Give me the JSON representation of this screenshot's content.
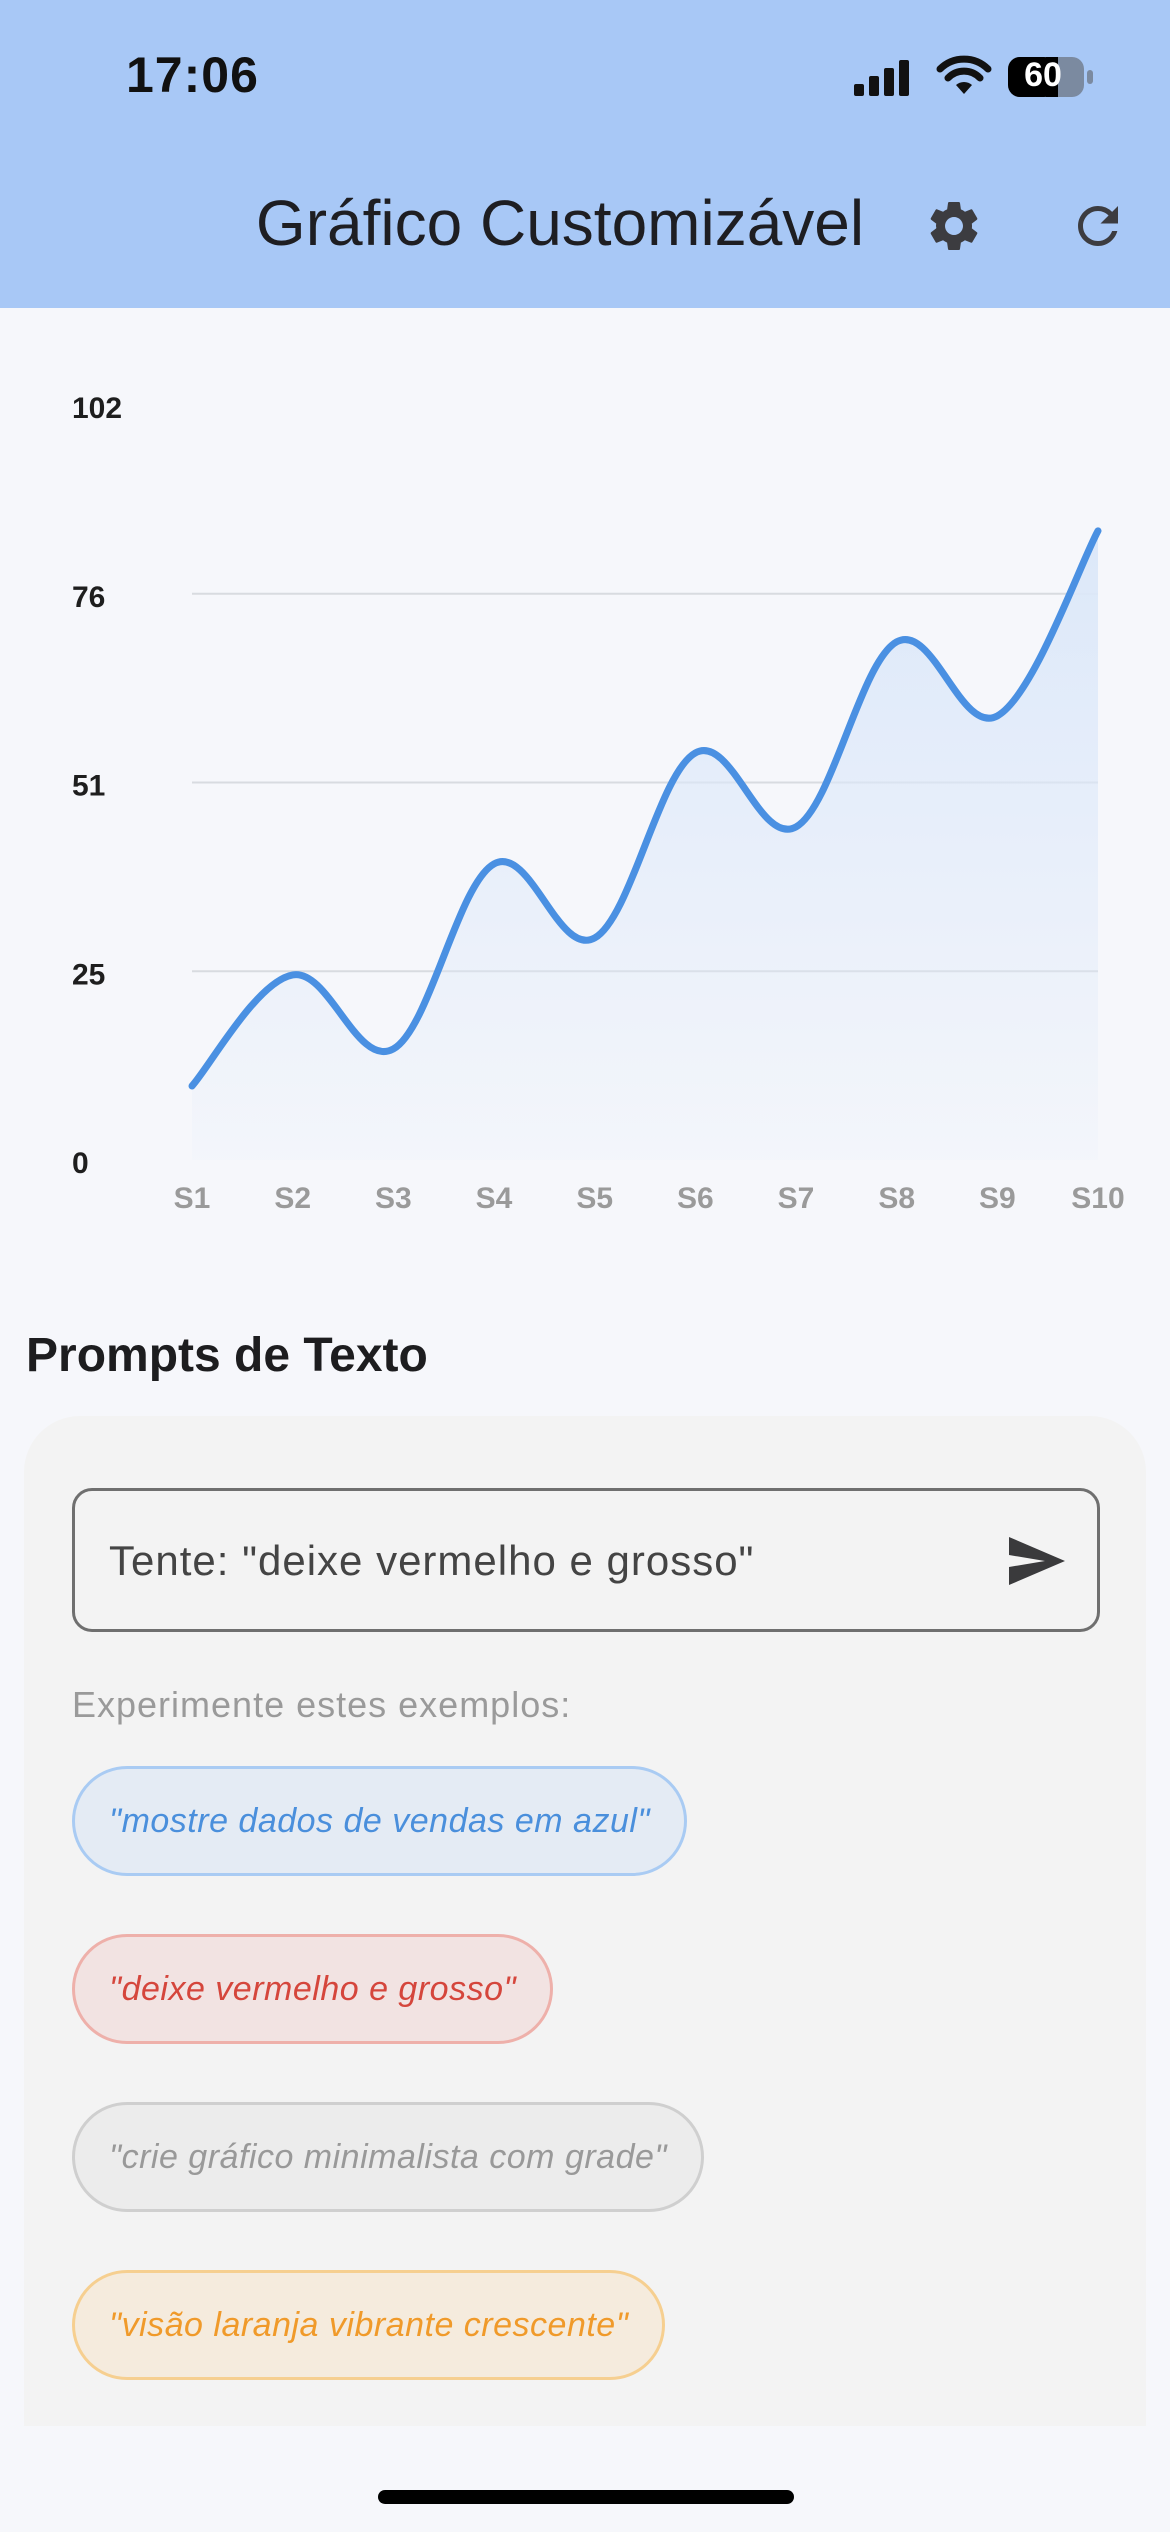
{
  "status_bar": {
    "time": "17:06",
    "battery": "60"
  },
  "header": {
    "title": "Gráfico Customizável",
    "settings_icon": "gear-icon",
    "refresh_icon": "refresh-icon"
  },
  "chart_data": {
    "type": "area",
    "categories": [
      "S1",
      "S2",
      "S3",
      "S4",
      "S5",
      "S6",
      "S7",
      "S8",
      "S9",
      "S10"
    ],
    "values": [
      10,
      25,
      15,
      40,
      30,
      55,
      45,
      70,
      60,
      85
    ],
    "yticks": [
      "102",
      "76",
      "51",
      "25",
      "0"
    ],
    "ylim": [
      0,
      102
    ],
    "line_color": "#4a90e2",
    "fill_color": "#dce8f9",
    "smooth": true,
    "grid": true
  },
  "prompts": {
    "section_title": "Prompts de Texto",
    "input_placeholder": "Tente: \"deixe vermelho e grosso\"",
    "examples_label": "Experimente estes exemplos:",
    "examples": [
      "\"mostre dados de vendas em azul\"",
      "\"deixe vermelho e grosso\"",
      "\"crie gráfico minimalista com grade\"",
      "\"visão laranja vibrante crescente\""
    ],
    "example_colors": [
      "#4a8fdc",
      "#d5463c",
      "#999999",
      "#f09a2a"
    ]
  }
}
